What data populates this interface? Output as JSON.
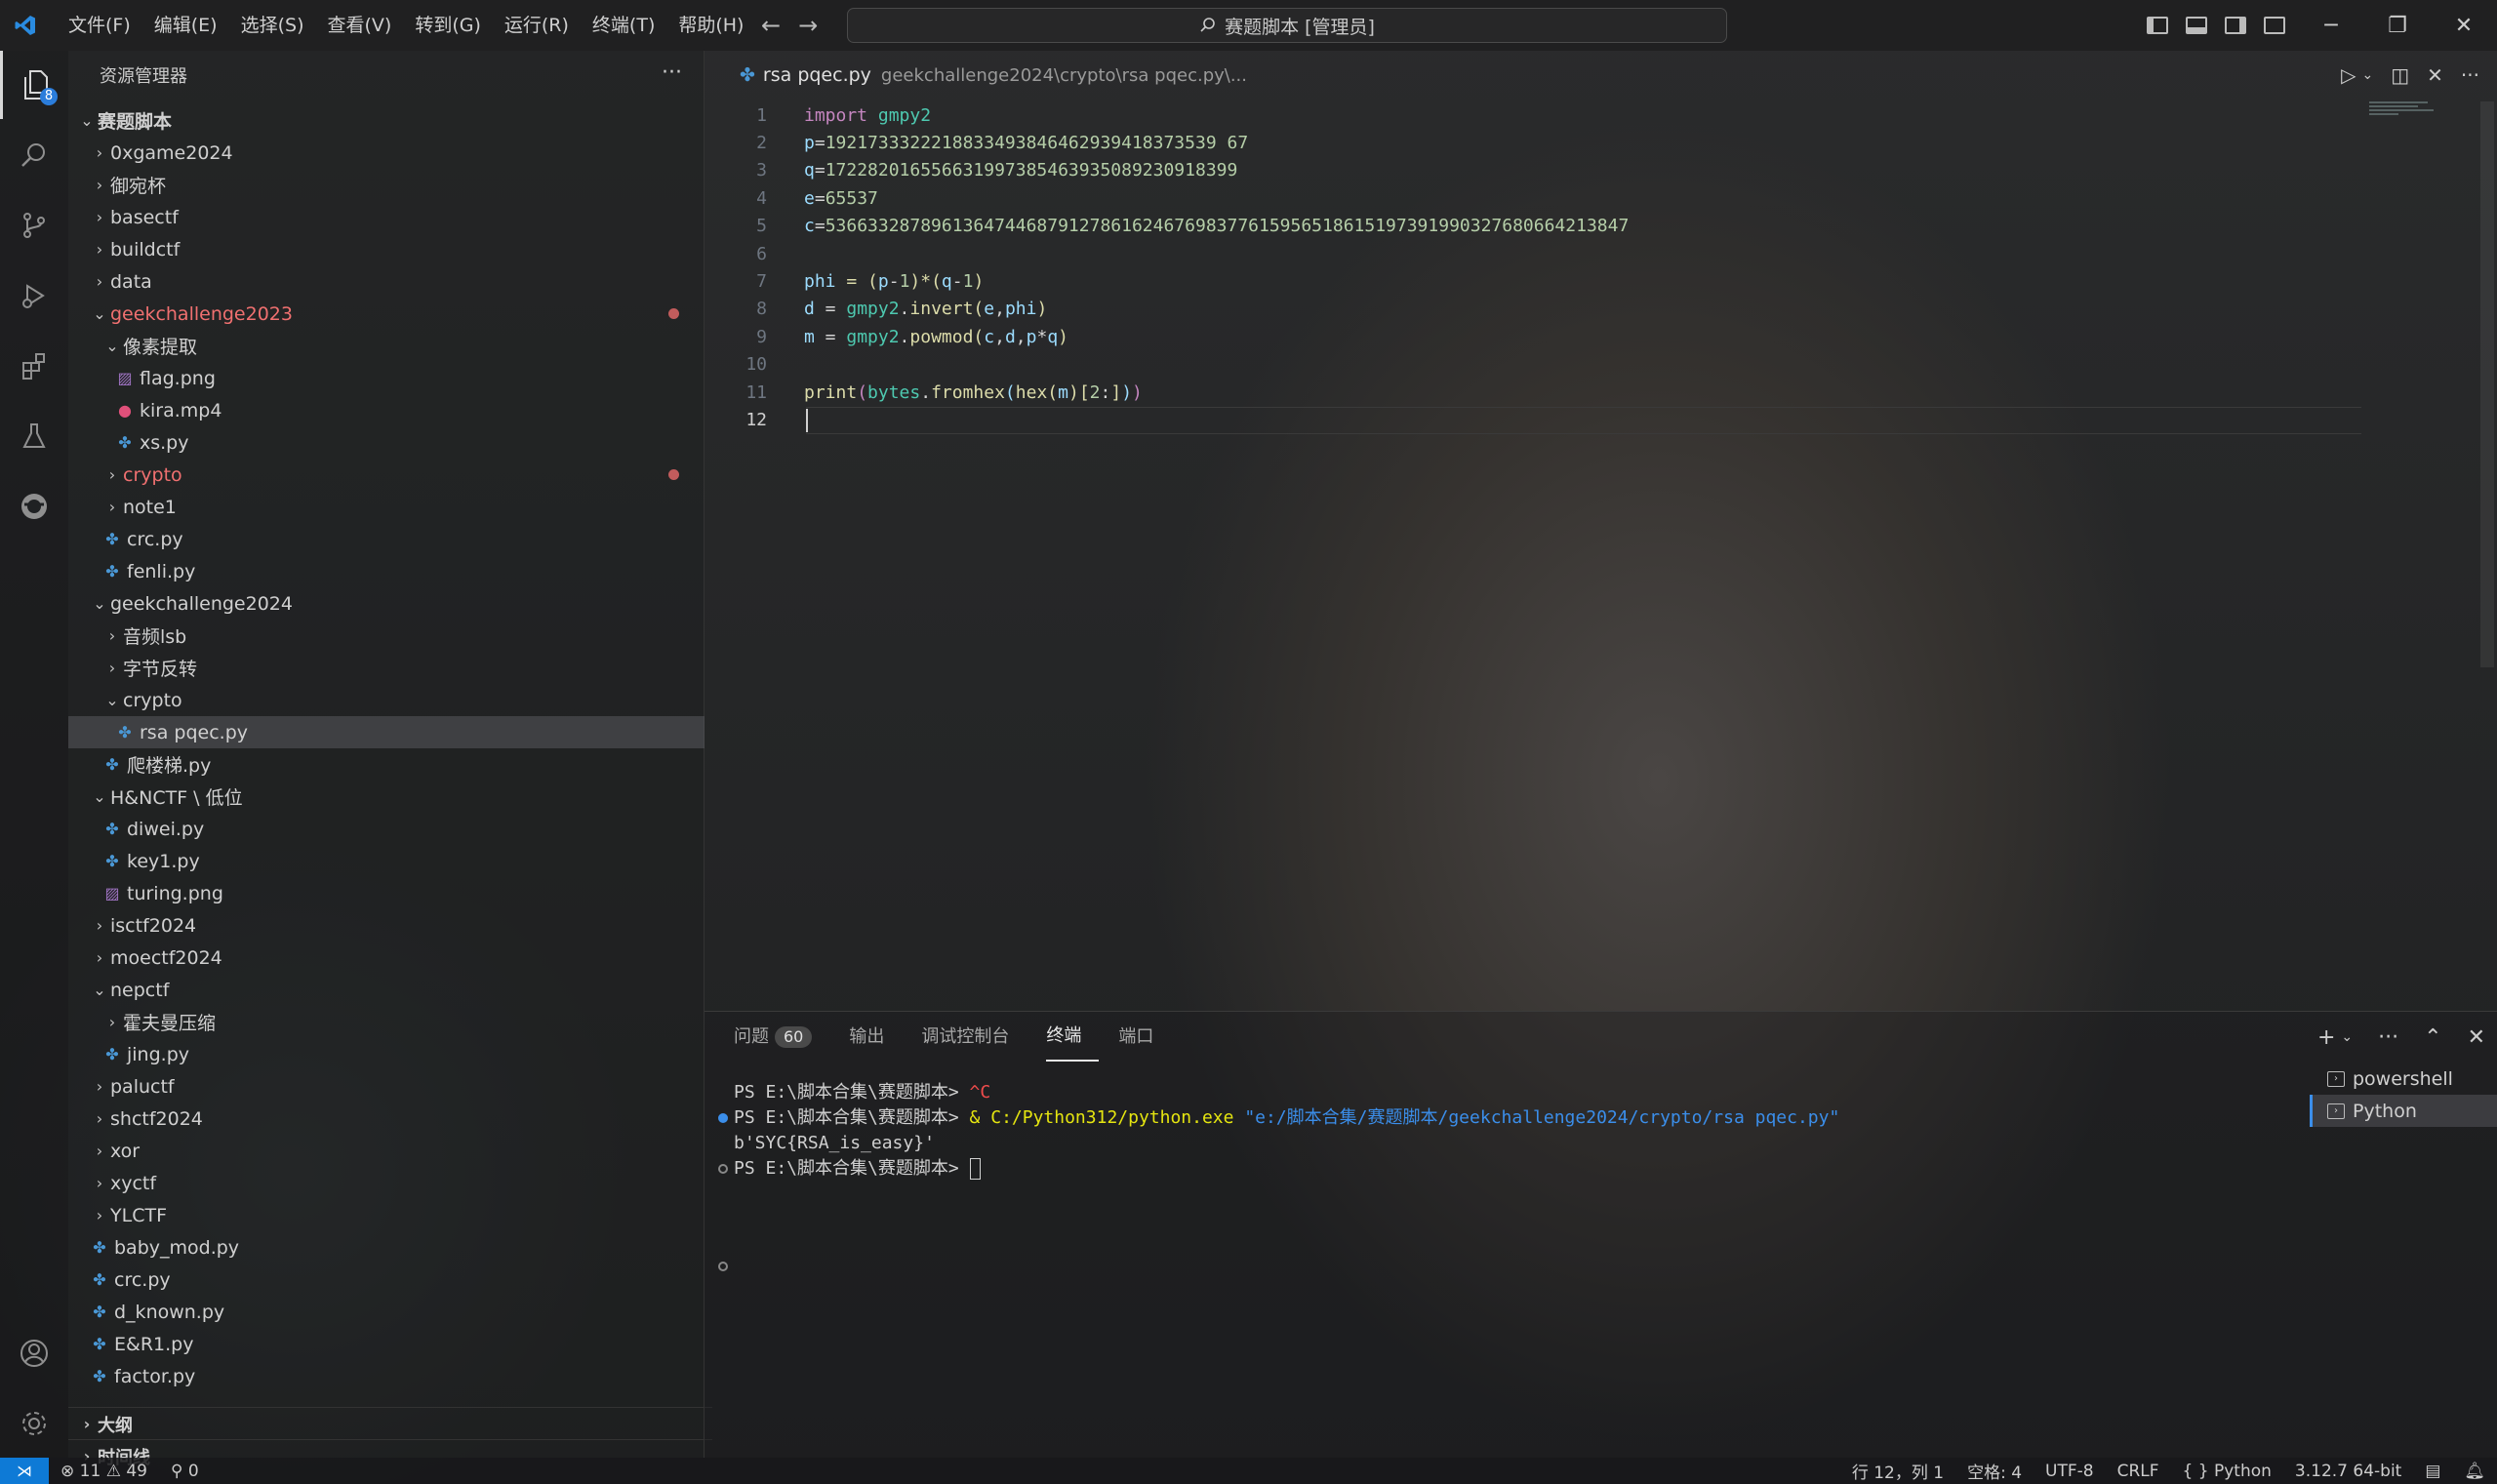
{
  "titlebar": {
    "menu": [
      "文件(F)",
      "编辑(E)",
      "选择(S)",
      "查看(V)",
      "转到(G)",
      "运行(R)",
      "终端(T)",
      "帮助(H)"
    ],
    "search_text": "赛题脚本 [管理员]"
  },
  "activitybar": {
    "explorer_badge": "8"
  },
  "sidebar": {
    "title": "资源管理器",
    "root": "赛题脚本",
    "items": [
      {
        "label": "0xgame2024",
        "depth": 1,
        "kind": "folder",
        "open": false
      },
      {
        "label": "御宛杯",
        "depth": 1,
        "kind": "folder",
        "open": false
      },
      {
        "label": "basectf",
        "depth": 1,
        "kind": "folder",
        "open": false
      },
      {
        "label": "buildctf",
        "depth": 1,
        "kind": "folder",
        "open": false
      },
      {
        "label": "data",
        "depth": 1,
        "kind": "folder",
        "open": false
      },
      {
        "label": "geekchallenge2023",
        "depth": 1,
        "kind": "folder",
        "open": true,
        "modified": true
      },
      {
        "label": "像素提取",
        "depth": 2,
        "kind": "folder",
        "open": true
      },
      {
        "label": "flag.png",
        "depth": 3,
        "kind": "png"
      },
      {
        "label": "kira.mp4",
        "depth": 3,
        "kind": "mp4"
      },
      {
        "label": "xs.py",
        "depth": 3,
        "kind": "py"
      },
      {
        "label": "crypto",
        "depth": 2,
        "kind": "folder",
        "open": false,
        "modified": true
      },
      {
        "label": "note1",
        "depth": 2,
        "kind": "folder",
        "open": false
      },
      {
        "label": "crc.py",
        "depth": 2,
        "kind": "py"
      },
      {
        "label": "fenli.py",
        "depth": 2,
        "kind": "py"
      },
      {
        "label": "geekchallenge2024",
        "depth": 1,
        "kind": "folder",
        "open": true
      },
      {
        "label": "音频lsb",
        "depth": 2,
        "kind": "folder",
        "open": false
      },
      {
        "label": "字节反转",
        "depth": 2,
        "kind": "folder",
        "open": false
      },
      {
        "label": "crypto",
        "depth": 2,
        "kind": "folder",
        "open": true
      },
      {
        "label": "rsa pqec.py",
        "depth": 3,
        "kind": "py",
        "selected": true
      },
      {
        "label": "爬楼梯.py",
        "depth": 2,
        "kind": "py"
      },
      {
        "label": "H&NCTF \\ 低位",
        "depth": 1,
        "kind": "folder",
        "open": true
      },
      {
        "label": "diwei.py",
        "depth": 2,
        "kind": "py"
      },
      {
        "label": "key1.py",
        "depth": 2,
        "kind": "py"
      },
      {
        "label": "turing.png",
        "depth": 2,
        "kind": "png"
      },
      {
        "label": "isctf2024",
        "depth": 1,
        "kind": "folder",
        "open": false
      },
      {
        "label": "moectf2024",
        "depth": 1,
        "kind": "folder",
        "open": false
      },
      {
        "label": "nepctf",
        "depth": 1,
        "kind": "folder",
        "open": true
      },
      {
        "label": "霍夫曼压缩",
        "depth": 2,
        "kind": "folder",
        "open": false
      },
      {
        "label": "jing.py",
        "depth": 2,
        "kind": "py"
      },
      {
        "label": "paluctf",
        "depth": 1,
        "kind": "folder",
        "open": false
      },
      {
        "label": "shctf2024",
        "depth": 1,
        "kind": "folder",
        "open": false
      },
      {
        "label": "xor",
        "depth": 1,
        "kind": "folder",
        "open": false
      },
      {
        "label": "xyctf",
        "depth": 1,
        "kind": "folder",
        "open": false
      },
      {
        "label": "YLCTF",
        "depth": 1,
        "kind": "folder",
        "open": false
      },
      {
        "label": "baby_mod.py",
        "depth": 1,
        "kind": "py"
      },
      {
        "label": "crc.py",
        "depth": 1,
        "kind": "py"
      },
      {
        "label": "d_known.py",
        "depth": 1,
        "kind": "py"
      },
      {
        "label": "E&R1.py",
        "depth": 1,
        "kind": "py"
      },
      {
        "label": "factor.py",
        "depth": 1,
        "kind": "py"
      }
    ],
    "outline": "大纲",
    "timeline": "时间线"
  },
  "editor": {
    "tab_name": "rsa pqec.py",
    "tab_path": "geekchallenge2024\\crypto\\rsa pqec.py\\...",
    "current_line": 12,
    "lines": [
      [
        {
          "t": "import",
          "c": "kw"
        },
        {
          "t": " ",
          "c": "pn"
        },
        {
          "t": "gmpy2",
          "c": "mod-c"
        }
      ],
      [
        {
          "t": "p",
          "c": "var"
        },
        {
          "t": "=",
          "c": "pn"
        },
        {
          "t": "1921733322218833493846462939418373539 67",
          "c": "num"
        }
      ],
      [
        {
          "t": "q",
          "c": "var"
        },
        {
          "t": "=",
          "c": "pn"
        },
        {
          "t": "172282016556631997385463935089230918399",
          "c": "num"
        }
      ],
      [
        {
          "t": "e",
          "c": "var"
        },
        {
          "t": "=",
          "c": "pn"
        },
        {
          "t": "65537",
          "c": "num"
        }
      ],
      [
        {
          "t": "c",
          "c": "var"
        },
        {
          "t": "=",
          "c": "pn"
        },
        {
          "t": "5366332878961364744687912786162467698377615956518615197391990327680664213847",
          "c": "num"
        }
      ],
      [],
      [
        {
          "t": "phi",
          "c": "var"
        },
        {
          "t": " = (",
          "c": "fn"
        },
        {
          "t": "p",
          "c": "var"
        },
        {
          "t": "-",
          "c": "pn"
        },
        {
          "t": "1",
          "c": "num"
        },
        {
          "t": ")*(",
          "c": "fn"
        },
        {
          "t": "q",
          "c": "var"
        },
        {
          "t": "-",
          "c": "pn"
        },
        {
          "t": "1",
          "c": "num"
        },
        {
          "t": ")",
          "c": "fn"
        }
      ],
      [
        {
          "t": "d",
          "c": "var"
        },
        {
          "t": " = ",
          "c": "pn"
        },
        {
          "t": "gmpy2",
          "c": "mod-c"
        },
        {
          "t": ".",
          "c": "pn"
        },
        {
          "t": "invert",
          "c": "fn"
        },
        {
          "t": "(",
          "c": "fn"
        },
        {
          "t": "e",
          "c": "var"
        },
        {
          "t": ",",
          "c": "pn"
        },
        {
          "t": "phi",
          "c": "var"
        },
        {
          "t": ")",
          "c": "fn"
        }
      ],
      [
        {
          "t": "m",
          "c": "var"
        },
        {
          "t": " = ",
          "c": "pn"
        },
        {
          "t": "gmpy2",
          "c": "mod-c"
        },
        {
          "t": ".",
          "c": "pn"
        },
        {
          "t": "powmod",
          "c": "fn"
        },
        {
          "t": "(",
          "c": "fn"
        },
        {
          "t": "c",
          "c": "var"
        },
        {
          "t": ",",
          "c": "pn"
        },
        {
          "t": "d",
          "c": "var"
        },
        {
          "t": ",",
          "c": "pn"
        },
        {
          "t": "p",
          "c": "var"
        },
        {
          "t": "*",
          "c": "pn"
        },
        {
          "t": "q",
          "c": "var"
        },
        {
          "t": ")",
          "c": "fn"
        }
      ],
      [],
      [
        {
          "t": "print",
          "c": "fn"
        },
        {
          "t": "(",
          "c": "kw"
        },
        {
          "t": "bytes",
          "c": "mod-c"
        },
        {
          "t": ".",
          "c": "pn"
        },
        {
          "t": "fromhex",
          "c": "fn"
        },
        {
          "t": "(",
          "c": "var"
        },
        {
          "t": "hex",
          "c": "fn"
        },
        {
          "t": "(",
          "c": "fn"
        },
        {
          "t": "m",
          "c": "var"
        },
        {
          "t": ")",
          "c": "fn"
        },
        {
          "t": "[",
          "c": "fn"
        },
        {
          "t": "2",
          "c": "num"
        },
        {
          "t": ":",
          "c": "pn"
        },
        {
          "t": "]",
          "c": "fn"
        },
        {
          "t": ")",
          "c": "var"
        },
        {
          "t": ")",
          "c": "kw"
        }
      ],
      []
    ]
  },
  "panel": {
    "tabs": [
      {
        "label": "问题",
        "badge": "60"
      },
      {
        "label": "输出"
      },
      {
        "label": "调试控制台"
      },
      {
        "label": "终端",
        "active": true
      },
      {
        "label": "端口"
      }
    ],
    "terminal": {
      "line1_prompt": "PS E:\\脚本合集\\赛题脚本> ",
      "line1_cmd": "^C",
      "line2_prompt": "PS E:\\脚本合集\\赛题脚本> ",
      "line2_amp": "& ",
      "line2_exe": "C:/Python312/python.exe",
      "line2_arg": "\"e:/脚本合集/赛题脚本/geekchallenge2024/crypto/rsa pqec.py\"",
      "line3": "b'SYC{RSA_is_easy}'",
      "line4_prompt": "PS E:\\脚本合集\\赛题脚本> "
    },
    "terminals": [
      "powershell",
      "Python"
    ]
  },
  "statusbar": {
    "errors": "11",
    "warnings": "49",
    "ports": "0",
    "position": "行 12，列 1",
    "spaces": "空格: 4",
    "encoding": "UTF-8",
    "eol": "CRLF",
    "language": "Python",
    "interpreter": "3.12.7 64-bit"
  }
}
